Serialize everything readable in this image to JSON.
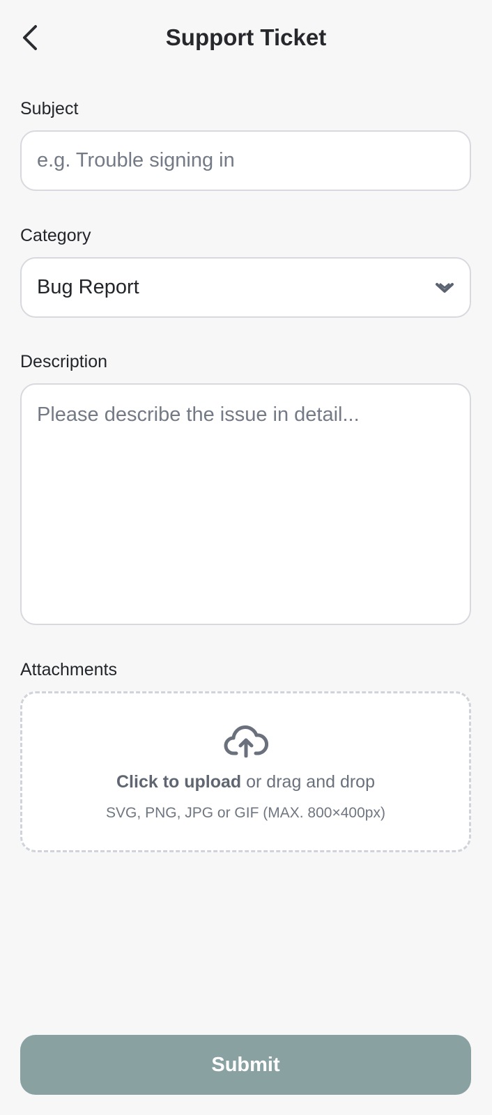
{
  "header": {
    "title": "Support Ticket",
    "back_icon": "chevron-left-icon"
  },
  "form": {
    "subject": {
      "label": "Subject",
      "value": "",
      "placeholder": "e.g. Trouble signing in"
    },
    "category": {
      "label": "Category",
      "selected": "Bug Report",
      "icon": "chevron-down-icon"
    },
    "description": {
      "label": "Description",
      "value": "",
      "placeholder": "Please describe the issue in detail..."
    },
    "attachments": {
      "label": "Attachments",
      "icon": "cloud-upload-icon",
      "cta_bold": "Click to upload",
      "cta_rest": " or drag and drop",
      "hint": "SVG, PNG, JPG or GIF (MAX. 800×400px)"
    }
  },
  "submit_label": "Submit",
  "colors": {
    "background": "#f7f7f7",
    "submit_bg": "#8aa1a1",
    "icon": "#6a717d"
  }
}
